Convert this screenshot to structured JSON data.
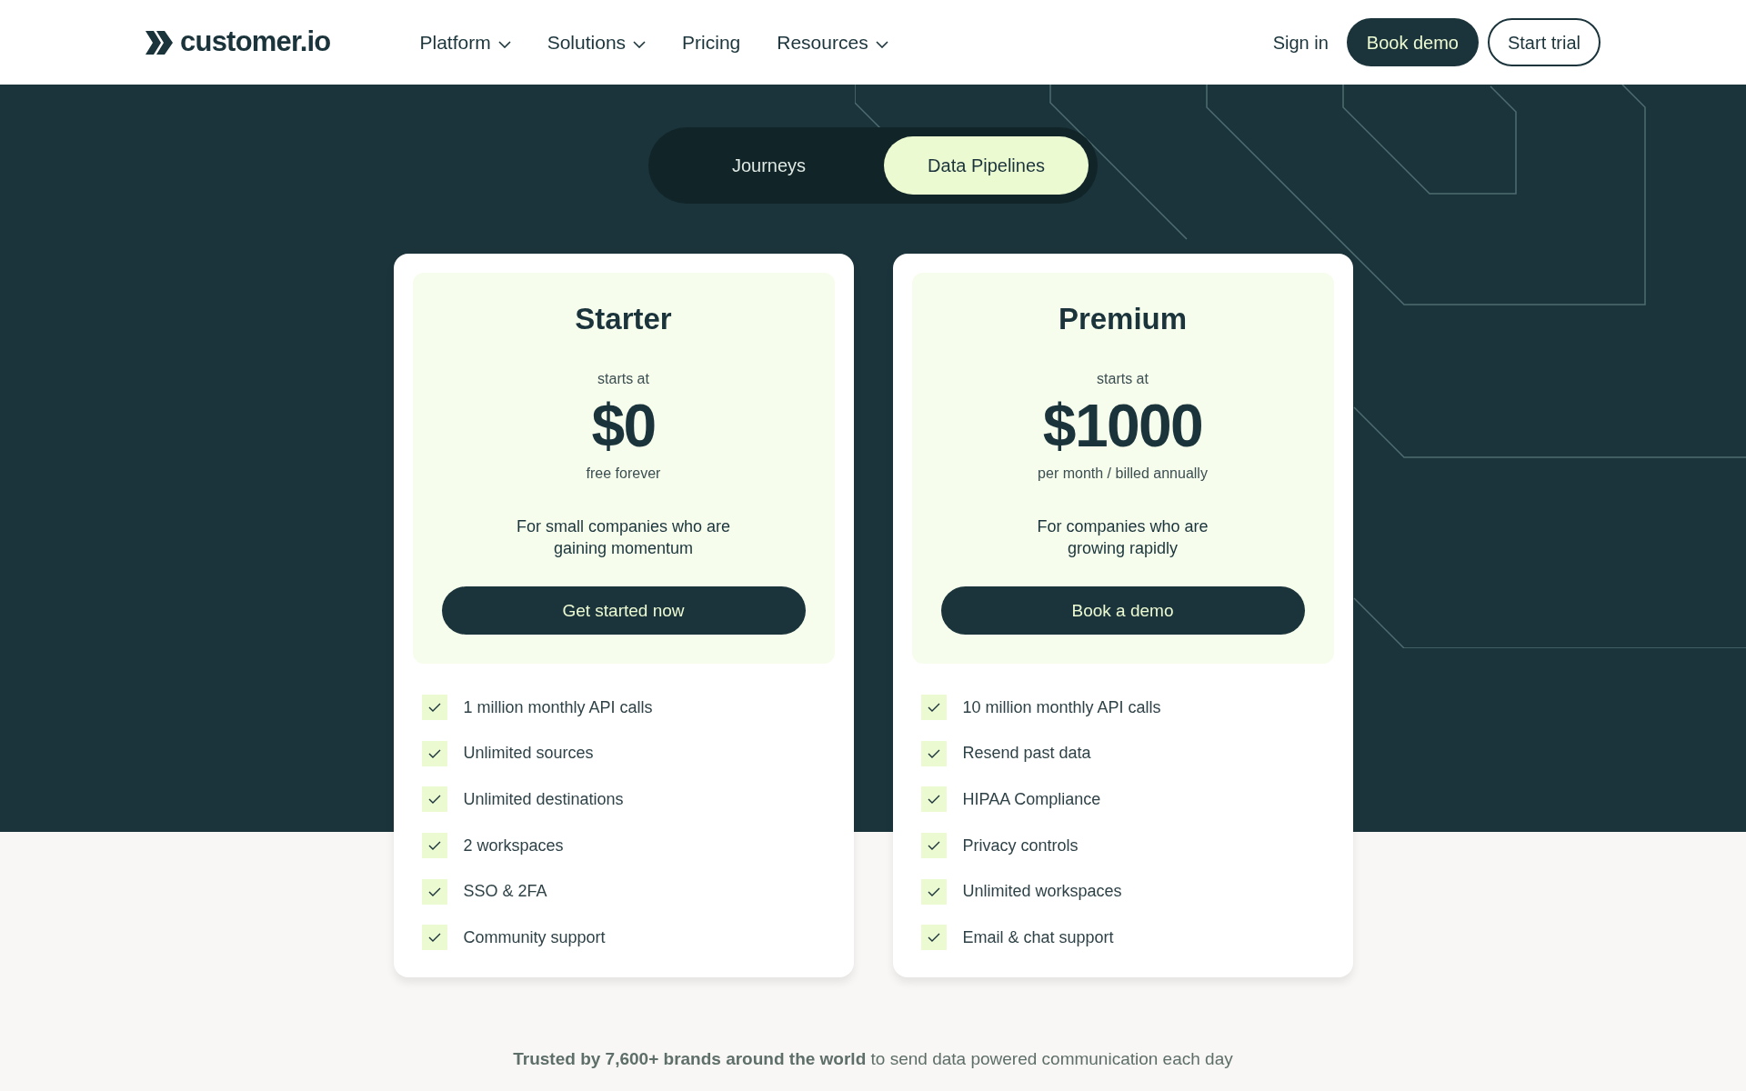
{
  "header": {
    "logo": "customer.io",
    "nav": [
      {
        "label": "Platform",
        "has_menu": true
      },
      {
        "label": "Solutions",
        "has_menu": true
      },
      {
        "label": "Pricing",
        "has_menu": false
      },
      {
        "label": "Resources",
        "has_menu": true
      }
    ],
    "sign_in": "Sign in",
    "book_demo": "Book demo",
    "start_trial": "Start trial"
  },
  "product_toggle": [
    {
      "label": "Journeys",
      "selected": false
    },
    {
      "label": "Data Pipelines",
      "selected": true
    }
  ],
  "plans": [
    {
      "name": "Starter",
      "starts_at": "starts at",
      "price": "$0",
      "period": "free forever",
      "description": "For small companies who are gaining momentum",
      "cta": "Get started now",
      "features": [
        "1 million monthly API calls",
        "Unlimited sources",
        "Unlimited destinations",
        "2 workspaces",
        "SSO & 2FA",
        "Community support"
      ]
    },
    {
      "name": "Premium",
      "starts_at": "starts at",
      "price": "$1000",
      "period": "per month / billed annually",
      "description": "For companies who are growing rapidly",
      "cta": "Book a demo",
      "features": [
        "10 million monthly API calls",
        "Resend past data",
        "HIPAA Compliance",
        "Privacy controls",
        "Unlimited workspaces",
        "Email & chat support"
      ]
    }
  ],
  "trust_line": "**Trusted by 7,600+ brands around the world** to send data powered communication each day"
}
